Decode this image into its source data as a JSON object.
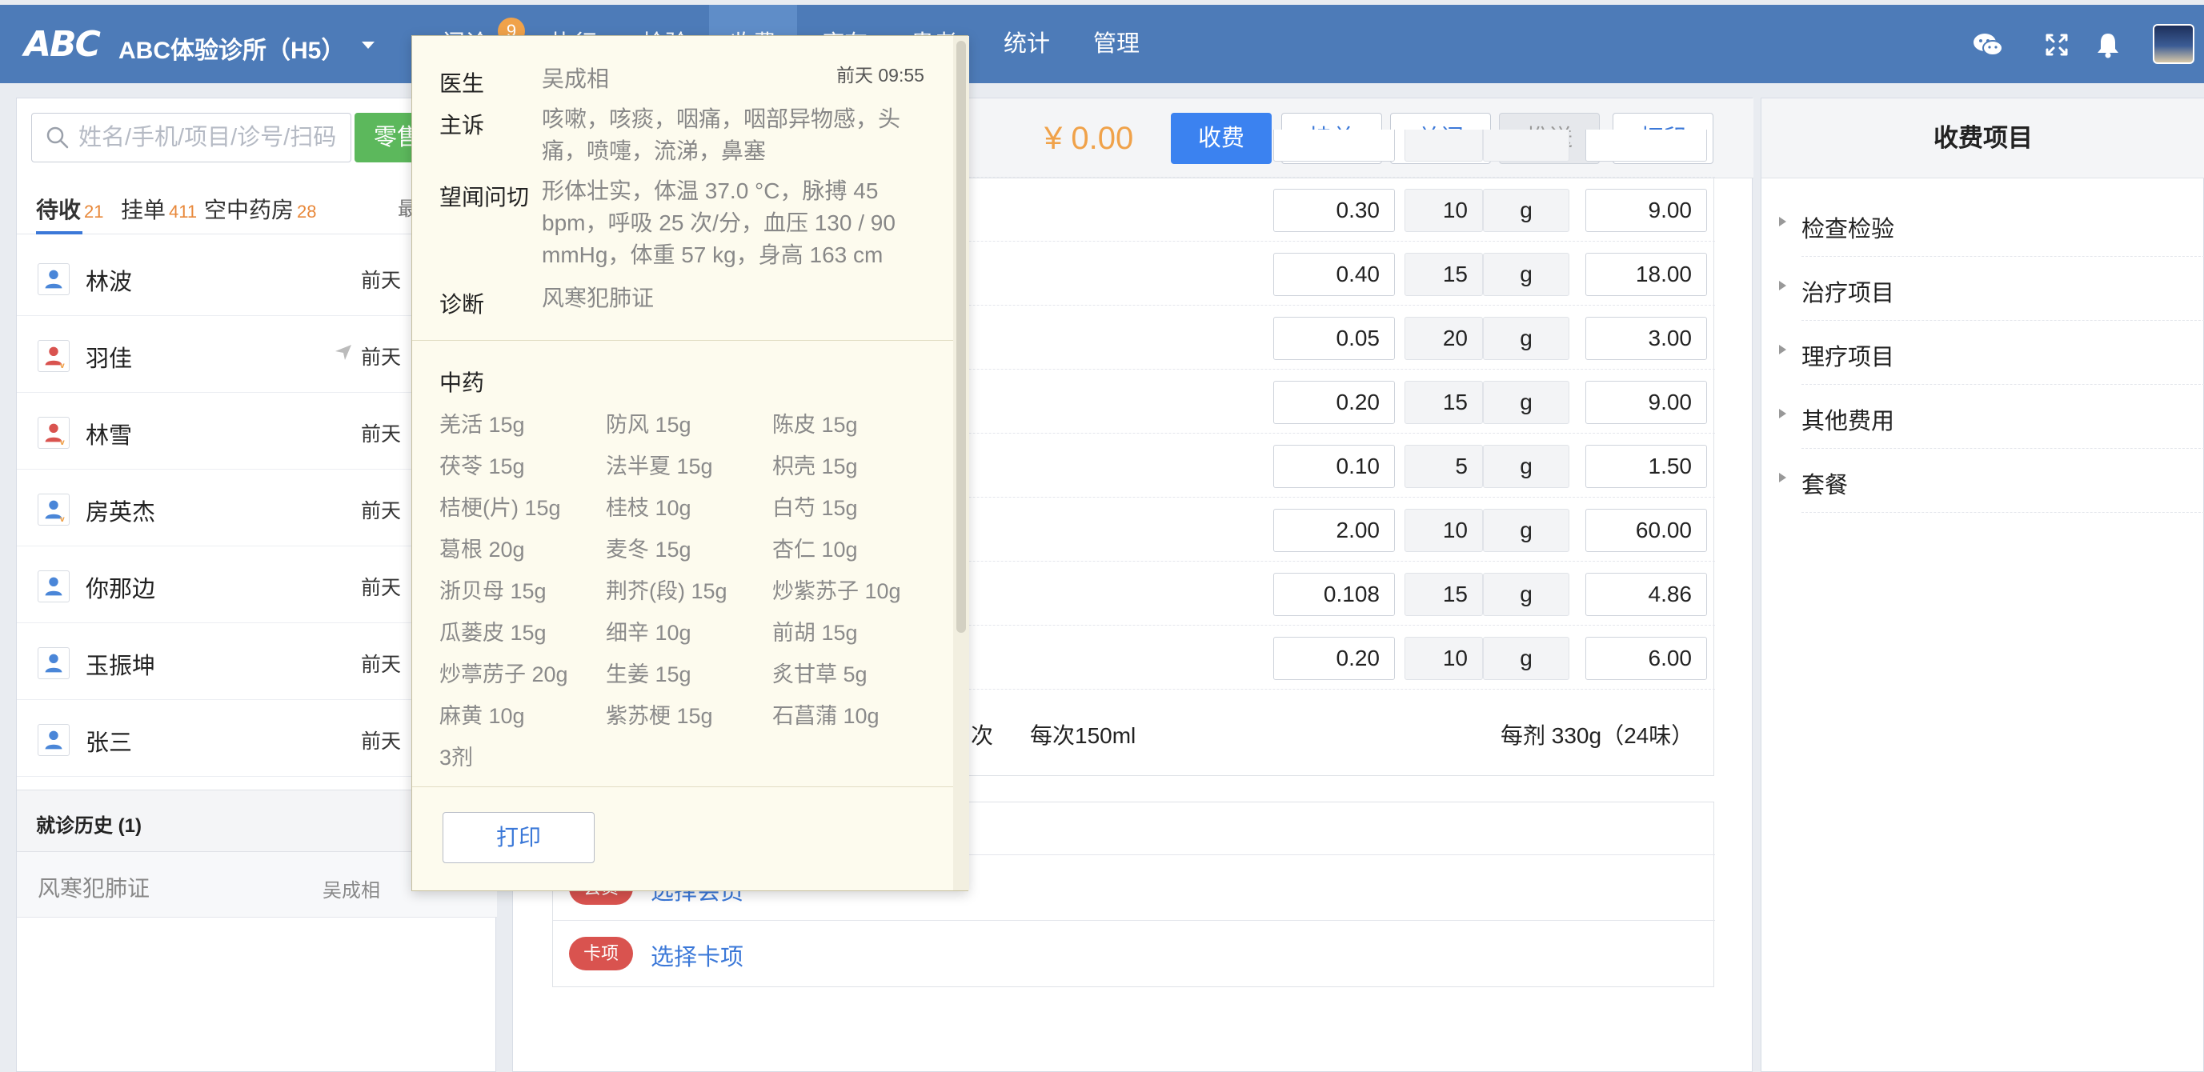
{
  "app": {
    "logo_text": "ABC",
    "clinic_name": "ABC体验诊所（H5）",
    "nav_badge": "9",
    "nav": [
      {
        "label": "门诊"
      },
      {
        "label": "执行"
      },
      {
        "label": "检验"
      },
      {
        "label": "收费"
      },
      {
        "label": "库存"
      },
      {
        "label": "患者"
      },
      {
        "label": "统计"
      },
      {
        "label": "管理"
      }
    ],
    "top_icons": [
      "wechat-icon",
      "fullscreen-icon",
      "bell-icon",
      "user-avatar"
    ]
  },
  "left": {
    "search_placeholder": "姓名/手机/项目/诊号/扫码",
    "retail_button": "零售",
    "tabs": [
      {
        "label": "待收",
        "count": "21"
      },
      {
        "label": "挂单",
        "count": "411"
      },
      {
        "label": "空中药房",
        "count": "28"
      }
    ],
    "recent_label": "最",
    "patients": [
      {
        "name": "林波",
        "time": "前天",
        "avatar": "male",
        "sent": false
      },
      {
        "name": "羽佳",
        "time": "前天",
        "avatar": "vip-female",
        "sent": true
      },
      {
        "name": "林雪",
        "time": "前天",
        "avatar": "vip-female",
        "sent": false
      },
      {
        "name": "房英杰",
        "time": "前天",
        "avatar": "vip-male",
        "sent": false
      },
      {
        "name": "你那边",
        "time": "前天",
        "avatar": "male",
        "sent": false
      },
      {
        "name": "玉振坤",
        "time": "前天",
        "avatar": "male",
        "sent": false
      },
      {
        "name": "张三",
        "time": "前天",
        "avatar": "male",
        "sent": false
      }
    ],
    "history_title": "就诊历史 (1)",
    "history": [
      {
        "diagnosis": "风寒犯肺证",
        "doctor": "吴成相"
      }
    ]
  },
  "center": {
    "amount": "¥ 0.00",
    "buttons": {
      "charge": "收费",
      "hold": "挂单",
      "close": "关闭",
      "push": "推送",
      "print": "打印"
    },
    "medicine_rows": [
      {
        "price": "0.30",
        "qty": "10",
        "unit": "g",
        "total": "9.00"
      },
      {
        "price": "0.40",
        "qty": "15",
        "unit": "g",
        "total": "18.00"
      },
      {
        "price": "0.05",
        "qty": "20",
        "unit": "g",
        "total": "3.00"
      },
      {
        "price": "0.20",
        "qty": "15",
        "unit": "g",
        "total": "9.00"
      },
      {
        "price": "0.10",
        "qty": "5",
        "unit": "g",
        "total": "1.50"
      },
      {
        "price": "2.00",
        "qty": "10",
        "unit": "g",
        "total": "60.00"
      },
      {
        "price": "0.108",
        "qty": "15",
        "unit": "g",
        "total": "4.86"
      },
      {
        "price": "0.20",
        "qty": "10",
        "unit": "g",
        "total": "6.00"
      }
    ],
    "footer_times": "次",
    "footer_dose": "每次150ml",
    "footer_weight": "每剂 330g（24味）",
    "extras": [
      {
        "tag": "会员",
        "link": "选择会员"
      },
      {
        "tag": "卡项",
        "link": "选择卡项"
      }
    ]
  },
  "right": {
    "title": "收费项目",
    "categories": [
      "检查检验",
      "治疗项目",
      "理疗项目",
      "其他费用",
      "套餐"
    ]
  },
  "popover": {
    "doctor_label": "医生",
    "doctor": "吴成相",
    "time": "前天 09:55",
    "complaint_label": "主诉",
    "complaint": "咳嗽，咳痰，咽痛，咽部异物感，头痛，喷嚏，流涕，鼻塞",
    "exam_label": "望闻问切",
    "exam": "形体壮实，体温 37.0 °C，脉搏 45 bpm，呼吸 25 次/分，血压 130 / 90 mmHg，体重 57 kg，身高 163 cm",
    "diagnosis_label": "诊断",
    "diagnosis": "风寒犯肺证",
    "section": "中药",
    "herbs": [
      "羌活 15g",
      "防风 15g",
      "陈皮 15g",
      "茯苓 15g",
      "法半夏 15g",
      "枳壳 15g",
      "桔梗(片) 15g",
      "桂枝 10g",
      "白芍 15g",
      "葛根 20g",
      "麦冬 15g",
      "杏仁 10g",
      "浙贝母 15g",
      "荆芥(段) 15g",
      "炒紫苏子 10g",
      "瓜蒌皮 15g",
      "细辛 10g",
      "前胡 15g",
      "炒葶苈子 20g",
      "生姜 15g",
      "炙甘草 5g",
      "麻黄 10g",
      "紫苏梗 15g",
      "石菖蒲 10g"
    ],
    "doses": "3剂",
    "print": "打印"
  }
}
